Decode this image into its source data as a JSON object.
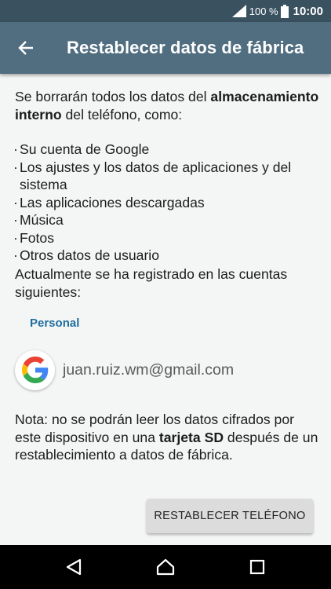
{
  "status_bar": {
    "battery_percent": "100 %",
    "time": "10:00",
    "signal_icon": "signal-icon",
    "battery_icon": "battery-icon"
  },
  "app_bar": {
    "title": "Restablecer datos de fábrica",
    "back_icon": "arrow-back-icon"
  },
  "content": {
    "intro": {
      "prefix": "Se borrarán todos los datos del ",
      "bold": "almacenamiento interno",
      "suffix": " del teléfono, como:"
    },
    "bullet_marker": "·",
    "bullets": [
      "Su cuenta de Google",
      "Los ajustes y los datos de aplicaciones y del sistema",
      "Las aplicaciones descargadas",
      "Música",
      "Fotos",
      "Otros datos de usuario"
    ],
    "accounts_note": "Actualmente se ha registrado en las cuentas siguientes:",
    "section_label": "Personal",
    "account": {
      "email": "juan.ruiz.wm@gmail.com",
      "icon": "google-g-icon"
    },
    "note": {
      "prefix": "Nota: no se podrán leer los datos cifrados por este dispositivo en una ",
      "bold": "tarjeta SD",
      "suffix": " después de un restablecimiento a datos de fábrica."
    },
    "reset_button_label": "RESTABLECER TELÉFONO"
  },
  "nav_bar": {
    "back_icon": "nav-back-icon",
    "home_icon": "nav-home-icon",
    "recent_icon": "nav-recent-apps-icon"
  },
  "colors": {
    "status_bar": "#3a5160",
    "app_bar": "#506e80",
    "accent": "#1f6fa0",
    "background": "#f4f5f5"
  }
}
